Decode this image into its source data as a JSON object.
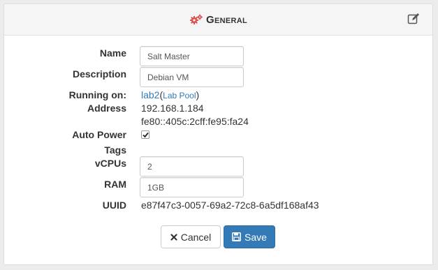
{
  "header": {
    "title": "General",
    "title_icon": "gears-icon",
    "edit_icon": "edit-icon",
    "accent_color": "#d9534f"
  },
  "fields": {
    "name": {
      "label": "Name",
      "value": "Salt Master"
    },
    "description": {
      "label": "Description",
      "value": "Debian VM"
    },
    "running_on": {
      "label": "Running on:",
      "host": "lab2",
      "pool": "Lab Pool"
    },
    "address": {
      "label": "Address",
      "ipv4": "192.168.1.184",
      "ipv6": "fe80::405c:2cff:fe95:fa24"
    },
    "auto_power": {
      "label": "Auto Power",
      "checked": true
    },
    "tags": {
      "label": "Tags"
    },
    "vcpus": {
      "label": "vCPUs",
      "value": "2"
    },
    "ram": {
      "label": "RAM",
      "value": "1GB"
    },
    "uuid": {
      "label": "UUID",
      "value": "e87f47c3-0057-69a2-72c8-6a5df168af43"
    }
  },
  "actions": {
    "cancel_label": "Cancel",
    "save_label": "Save",
    "primary_color": "#337ab7"
  }
}
